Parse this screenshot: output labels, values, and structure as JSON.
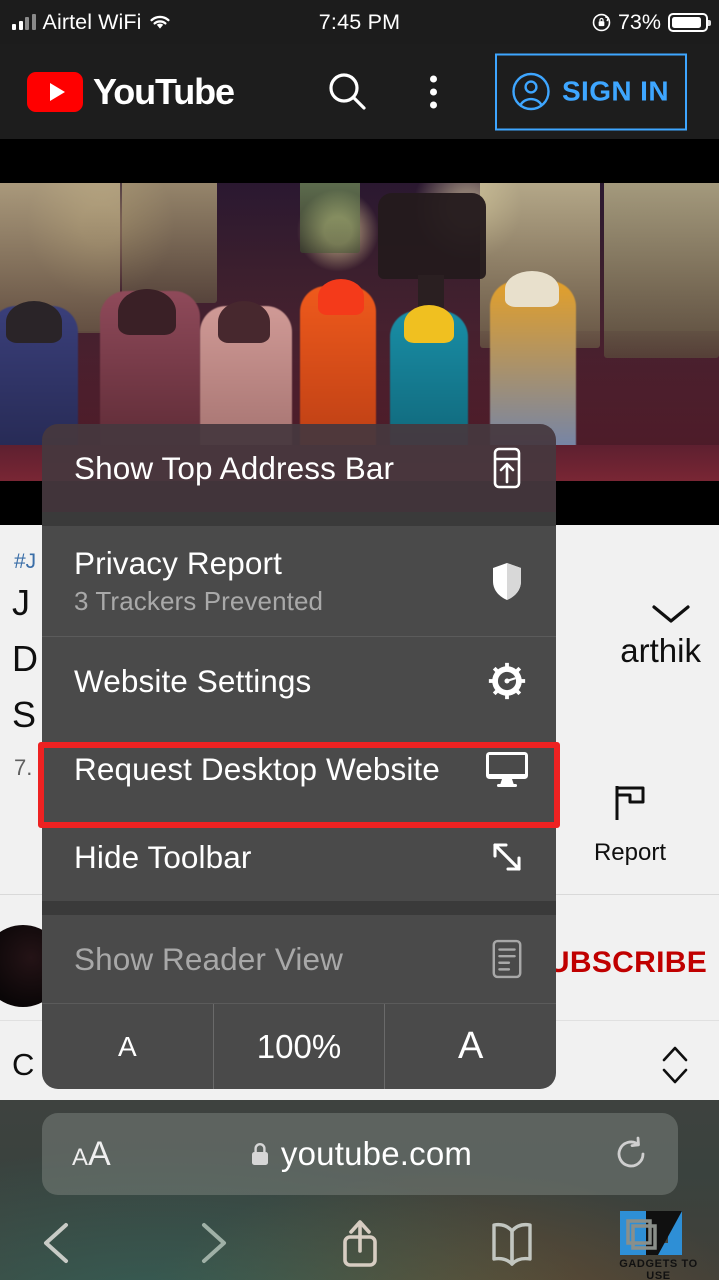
{
  "status_bar": {
    "carrier": "Airtel WiFi",
    "time": "7:45 PM",
    "battery_percent": "73%",
    "signal_bars_filled": 2,
    "signal_bars_total": 4,
    "wifi_icon": "wifi-icon",
    "orientation_lock_icon": "rotation-lock-icon",
    "battery_icon": "battery-icon"
  },
  "youtube_header": {
    "logo_text": "YouTube",
    "logo_icon": "youtube-play-icon",
    "search_icon": "search-icon",
    "more_icon": "kebab-menu-icon",
    "sign_in_label": "SIGN IN",
    "sign_in_icon": "account-circle-icon",
    "accent_blue": "#3ea6ff",
    "brand_red": "#ff0000",
    "background": "#1d1d1d"
  },
  "page": {
    "hashtag": "#J",
    "title_lines": [
      "J",
      "D",
      "S"
    ],
    "views": "7.",
    "collapse_icon": "chevron-down-icon",
    "channel_name": "arthik",
    "report_label": "Report",
    "report_icon": "flag-icon",
    "subscribe_label": "SUBSCRIBE",
    "subscribe_color": "#c00000",
    "comments_label": "C",
    "sort_icon": "up-down-arrows-icon",
    "avatar_icon": "channel-avatar"
  },
  "context_menu": {
    "items": [
      {
        "label": "Show Top Address Bar",
        "icon": "address-bar-top-icon",
        "subtitle": null,
        "dim": false,
        "highlighted": false
      },
      {
        "label": "Privacy Report",
        "icon": "shield-icon",
        "subtitle": "3 Trackers Prevented",
        "dim": false,
        "highlighted": false
      },
      {
        "label": "Website Settings",
        "icon": "gear-icon",
        "subtitle": null,
        "dim": false,
        "highlighted": false
      },
      {
        "label": "Request Desktop Website",
        "icon": "desktop-monitor-icon",
        "subtitle": null,
        "dim": false,
        "highlighted": true
      },
      {
        "label": "Hide Toolbar",
        "icon": "expand-diagonal-icon",
        "subtitle": null,
        "dim": false,
        "highlighted": false
      },
      {
        "label": "Show Reader View",
        "icon": "reader-document-icon",
        "subtitle": null,
        "dim": true,
        "highlighted": false
      }
    ],
    "zoom_row": {
      "decrease_label": "A",
      "level": "100%",
      "increase_label": "A"
    },
    "highlight_color": "#ee2222",
    "background": "#4a4a4a"
  },
  "browser_bar": {
    "text_size_small": "A",
    "text_size_large": "A",
    "text_size_icon": "text-size-icon",
    "lock_icon": "lock-icon",
    "url": "youtube.com",
    "reload_icon": "reload-icon",
    "back_icon": "chevron-left-icon",
    "forward_icon": "chevron-right-icon",
    "share_icon": "share-icon",
    "bookmarks_icon": "book-icon"
  },
  "watermark": {
    "text": "GADGETS TO USE",
    "accent": "#2e8fd6"
  }
}
